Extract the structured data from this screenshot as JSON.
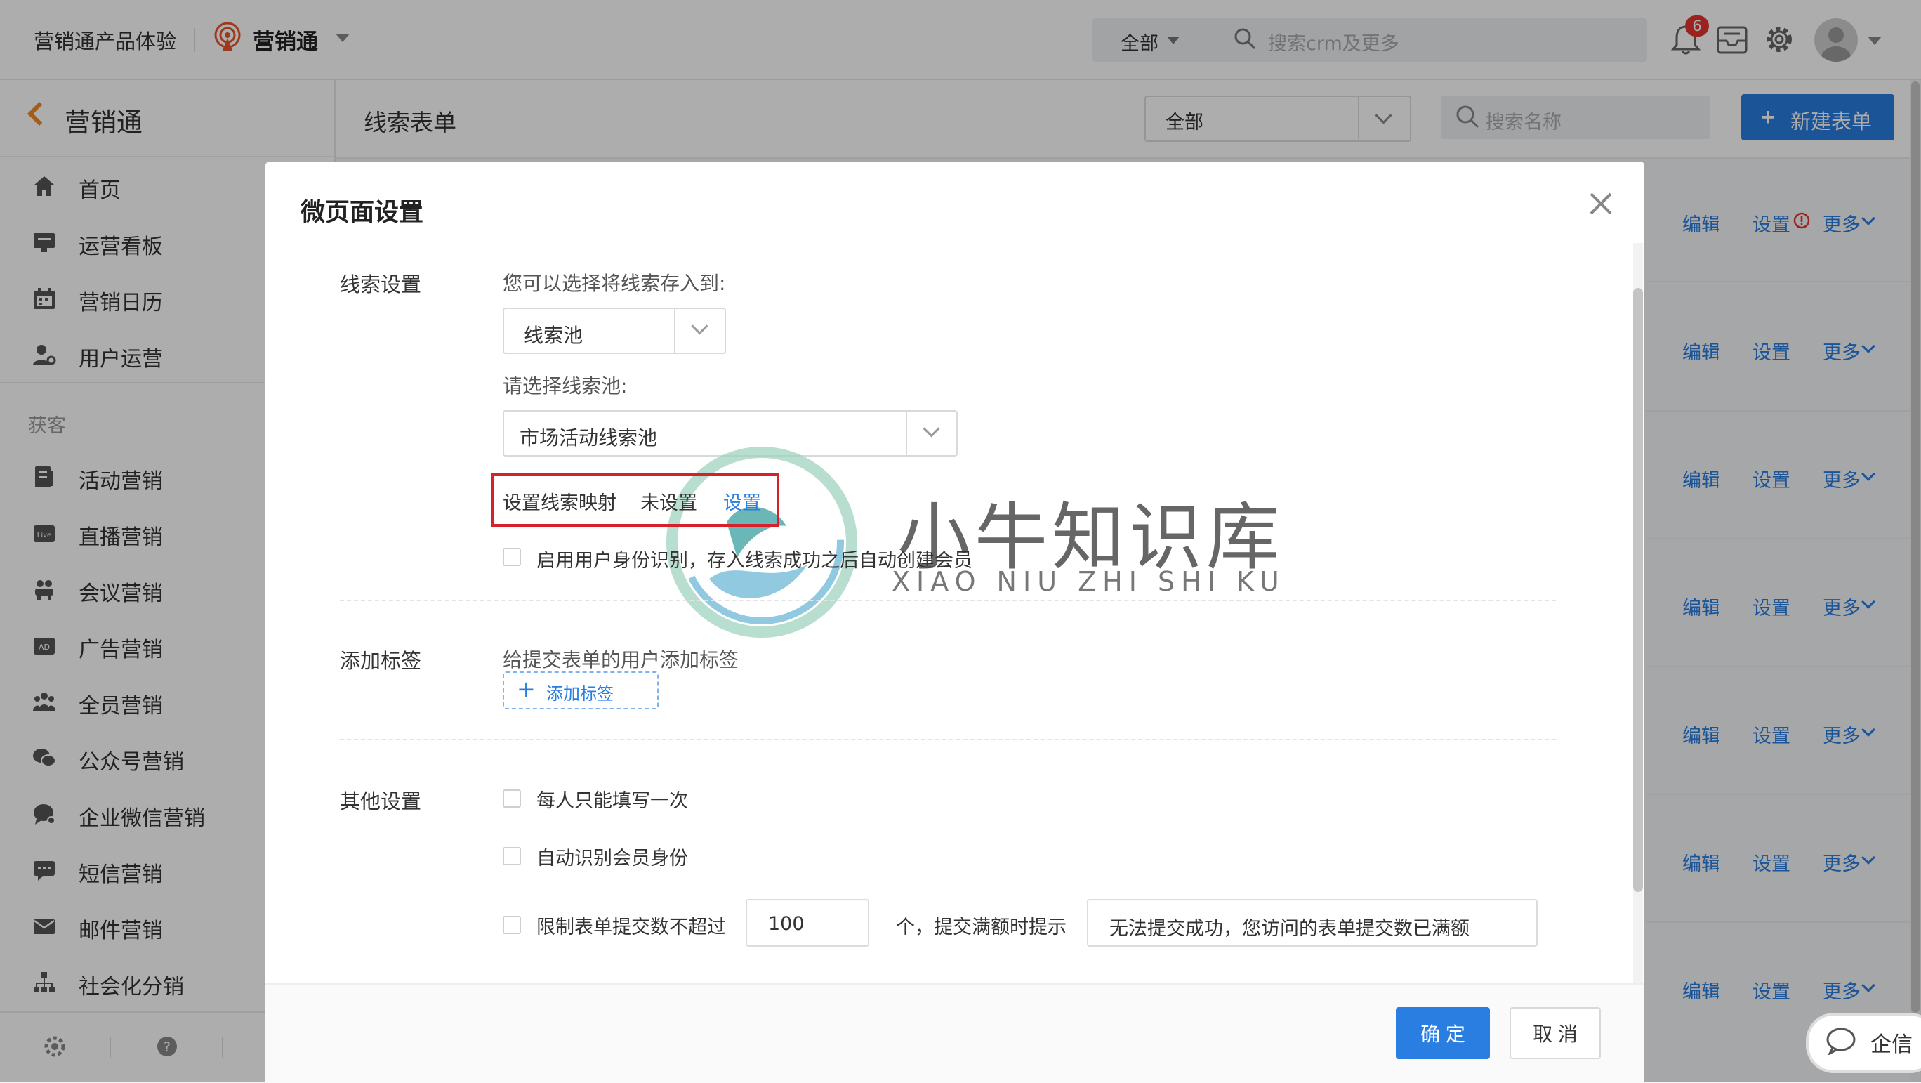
{
  "topbar": {
    "app_name": "营销通产品体验",
    "brand": "营销通",
    "scope": "全部",
    "search_placeholder": "搜索crm及更多",
    "notification_count": "6"
  },
  "sidebar": {
    "back_title": "营销通",
    "items_top": [
      {
        "label": "首页",
        "icon": "home-icon"
      },
      {
        "label": "运营看板",
        "icon": "dashboard-icon"
      },
      {
        "label": "营销日历",
        "icon": "calendar-icon"
      },
      {
        "label": "用户运营",
        "icon": "user-ops-icon"
      }
    ],
    "section": "获客",
    "items": [
      {
        "label": "活动营销",
        "icon": "activity-icon"
      },
      {
        "label": "直播营销",
        "icon": "live-icon"
      },
      {
        "label": "会议营销",
        "icon": "meeting-icon"
      },
      {
        "label": "广告营销",
        "icon": "ad-icon"
      },
      {
        "label": "全员营销",
        "icon": "team-icon"
      },
      {
        "label": "公众号营销",
        "icon": "wechat-icon"
      },
      {
        "label": "企业微信营销",
        "icon": "wecom-icon"
      },
      {
        "label": "短信营销",
        "icon": "sms-icon"
      },
      {
        "label": "邮件营销",
        "icon": "mail-icon"
      },
      {
        "label": "社会化分销",
        "icon": "distribution-icon"
      }
    ]
  },
  "content": {
    "title": "线索表单",
    "filter": "全部",
    "search_placeholder": "搜索名称",
    "new_button": "新建表单",
    "row_actions": {
      "edit": "编辑",
      "settings": "设置",
      "more": "更多"
    }
  },
  "dialog": {
    "title": "微页面设置",
    "lead": {
      "section": "线索设置",
      "store_label": "您可以选择将线索存入到:",
      "store_value": "线索池",
      "pool_label": "请选择线索池:",
      "pool_value": "市场活动线索池",
      "mapping_label": "设置线索映射",
      "mapping_status": "未设置",
      "mapping_link": "设置",
      "identity_checkbox": "启用用户身份识别，存入线索成功之后自动创建会员"
    },
    "tags": {
      "section": "添加标签",
      "hint": "给提交表单的用户添加标签",
      "add_button": "添加标签"
    },
    "other": {
      "section": "其他设置",
      "once_checkbox": "每人只能填写一次",
      "auto_member_checkbox": "自动识别会员身份",
      "limit_checkbox": "限制表单提交数不超过",
      "limit_value": "100",
      "limit_unit": "个，提交满额时提示",
      "limit_message": "无法提交成功，您访问的表单提交数已满额"
    },
    "ok": "确 定",
    "cancel": "取 消"
  },
  "chat_widget": "企信",
  "watermark": {
    "cn": "小牛知识库",
    "en": "XIAO NIU ZHI SHI KU"
  }
}
